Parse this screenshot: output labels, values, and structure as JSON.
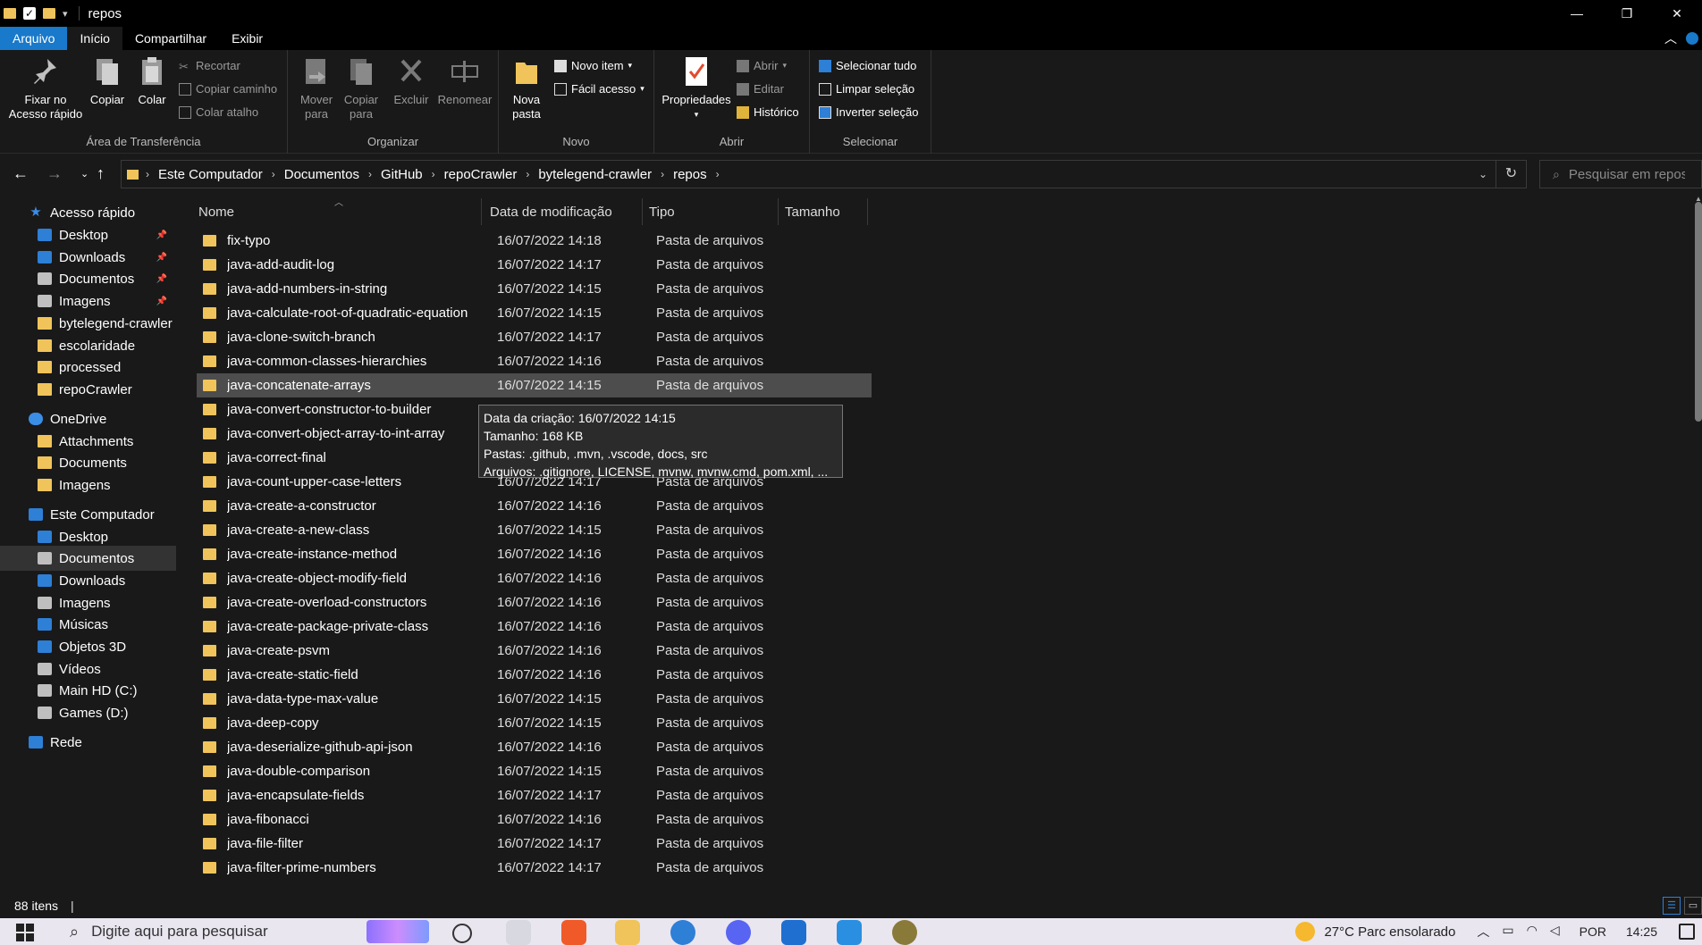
{
  "window": {
    "title": "repos",
    "controls": {
      "minimize": "—",
      "maximize": "❐",
      "close": "✕"
    }
  },
  "ribbon_tabs": [
    "Arquivo",
    "Início",
    "Compartilhar",
    "Exibir"
  ],
  "ribbon": {
    "clipboard": {
      "label": "Área de Transferência",
      "pin": "Fixar no Acesso rápido",
      "copy": "Copiar",
      "paste": "Colar",
      "cut": "Recortar",
      "copy_path": "Copiar caminho",
      "paste_shortcut": "Colar atalho"
    },
    "organize": {
      "label": "Organizar",
      "move_to": "Mover para",
      "copy_to": "Copiar para",
      "delete": "Excluir",
      "rename": "Renomear"
    },
    "new": {
      "label": "Novo",
      "new_folder": "Nova pasta",
      "new_item": "Novo item",
      "easy_access": "Fácil acesso"
    },
    "open": {
      "label": "Abrir",
      "properties": "Propriedades",
      "open": "Abrir",
      "edit": "Editar",
      "history": "Histórico"
    },
    "select": {
      "label": "Selecionar",
      "select_all": "Selecionar tudo",
      "select_none": "Limpar seleção",
      "invert": "Inverter seleção"
    }
  },
  "breadcrumb": [
    "Este Computador",
    "Documentos",
    "GitHub",
    "repoCrawler",
    "bytelegend-crawler",
    "repos"
  ],
  "search": {
    "placeholder": "Pesquisar em repos"
  },
  "nav": [
    {
      "label": "Acesso rápido",
      "icon": "star-icon",
      "level": 0,
      "pinned": false
    },
    {
      "label": "Desktop",
      "icon": "desktop-icon",
      "level": 1,
      "pinned": true
    },
    {
      "label": "Downloads",
      "icon": "download-icon",
      "level": 1,
      "pinned": true
    },
    {
      "label": "Documentos",
      "icon": "documents-icon",
      "level": 1,
      "pinned": true
    },
    {
      "label": "Imagens",
      "icon": "pictures-icon",
      "level": 1,
      "pinned": true
    },
    {
      "label": "bytelegend-crawler",
      "icon": "folder-icon",
      "level": 1,
      "pinned": false
    },
    {
      "label": "escolaridade",
      "icon": "folder-icon",
      "level": 1,
      "pinned": false
    },
    {
      "label": "processed",
      "icon": "folder-icon",
      "level": 1,
      "pinned": false
    },
    {
      "label": "repoCrawler",
      "icon": "folder-icon",
      "level": 1,
      "pinned": false
    },
    {
      "label": "OneDrive",
      "icon": "cloud-icon",
      "level": 0,
      "pinned": false
    },
    {
      "label": "Attachments",
      "icon": "folder-icon",
      "level": 1,
      "pinned": false
    },
    {
      "label": "Documents",
      "icon": "folder-icon",
      "level": 1,
      "pinned": false
    },
    {
      "label": "Imagens",
      "icon": "folder-icon",
      "level": 1,
      "pinned": false
    },
    {
      "label": "Este Computador",
      "icon": "computer-icon",
      "level": 0,
      "pinned": false
    },
    {
      "label": "Desktop",
      "icon": "desktop-icon",
      "level": 1,
      "pinned": false
    },
    {
      "label": "Documentos",
      "icon": "documents-icon",
      "level": 1,
      "pinned": false,
      "selected": true
    },
    {
      "label": "Downloads",
      "icon": "download-icon",
      "level": 1,
      "pinned": false
    },
    {
      "label": "Imagens",
      "icon": "pictures-icon",
      "level": 1,
      "pinned": false
    },
    {
      "label": "Músicas",
      "icon": "music-icon",
      "level": 1,
      "pinned": false
    },
    {
      "label": "Objetos 3D",
      "icon": "objects-3d-icon",
      "level": 1,
      "pinned": false
    },
    {
      "label": "Vídeos",
      "icon": "videos-icon",
      "level": 1,
      "pinned": false
    },
    {
      "label": "Main HD (C:)",
      "icon": "drive-icon",
      "level": 1,
      "pinned": false
    },
    {
      "label": "Games (D:)",
      "icon": "drive-icon",
      "level": 1,
      "pinned": false
    },
    {
      "label": "Rede",
      "icon": "network-icon",
      "level": 0,
      "pinned": false
    }
  ],
  "columns": [
    "Nome",
    "Data de modificação",
    "Tipo",
    "Tamanho"
  ],
  "files": [
    {
      "name": "fix-typo",
      "date": "16/07/2022 14:18",
      "type": "Pasta de arquivos"
    },
    {
      "name": "java-add-audit-log",
      "date": "16/07/2022 14:17",
      "type": "Pasta de arquivos"
    },
    {
      "name": "java-add-numbers-in-string",
      "date": "16/07/2022 14:15",
      "type": "Pasta de arquivos"
    },
    {
      "name": "java-calculate-root-of-quadratic-equation",
      "date": "16/07/2022 14:15",
      "type": "Pasta de arquivos"
    },
    {
      "name": "java-clone-switch-branch",
      "date": "16/07/2022 14:17",
      "type": "Pasta de arquivos"
    },
    {
      "name": "java-common-classes-hierarchies",
      "date": "16/07/2022 14:16",
      "type": "Pasta de arquivos"
    },
    {
      "name": "java-concatenate-arrays",
      "date": "16/07/2022 14:15",
      "type": "Pasta de arquivos",
      "hover": true
    },
    {
      "name": "java-convert-constructor-to-builder",
      "date": "",
      "type": ""
    },
    {
      "name": "java-convert-object-array-to-int-array",
      "date": "",
      "type": ""
    },
    {
      "name": "java-correct-final",
      "date": "",
      "type": ""
    },
    {
      "name": "java-count-upper-case-letters",
      "date": "16/07/2022 14:17",
      "type": "Pasta de arquivos"
    },
    {
      "name": "java-create-a-constructor",
      "date": "16/07/2022 14:16",
      "type": "Pasta de arquivos"
    },
    {
      "name": "java-create-a-new-class",
      "date": "16/07/2022 14:15",
      "type": "Pasta de arquivos"
    },
    {
      "name": "java-create-instance-method",
      "date": "16/07/2022 14:16",
      "type": "Pasta de arquivos"
    },
    {
      "name": "java-create-object-modify-field",
      "date": "16/07/2022 14:16",
      "type": "Pasta de arquivos"
    },
    {
      "name": "java-create-overload-constructors",
      "date": "16/07/2022 14:16",
      "type": "Pasta de arquivos"
    },
    {
      "name": "java-create-package-private-class",
      "date": "16/07/2022 14:16",
      "type": "Pasta de arquivos"
    },
    {
      "name": "java-create-psvm",
      "date": "16/07/2022 14:16",
      "type": "Pasta de arquivos"
    },
    {
      "name": "java-create-static-field",
      "date": "16/07/2022 14:16",
      "type": "Pasta de arquivos"
    },
    {
      "name": "java-data-type-max-value",
      "date": "16/07/2022 14:15",
      "type": "Pasta de arquivos"
    },
    {
      "name": "java-deep-copy",
      "date": "16/07/2022 14:15",
      "type": "Pasta de arquivos"
    },
    {
      "name": "java-deserialize-github-api-json",
      "date": "16/07/2022 14:16",
      "type": "Pasta de arquivos"
    },
    {
      "name": "java-double-comparison",
      "date": "16/07/2022 14:15",
      "type": "Pasta de arquivos"
    },
    {
      "name": "java-encapsulate-fields",
      "date": "16/07/2022 14:17",
      "type": "Pasta de arquivos"
    },
    {
      "name": "java-fibonacci",
      "date": "16/07/2022 14:16",
      "type": "Pasta de arquivos"
    },
    {
      "name": "java-file-filter",
      "date": "16/07/2022 14:17",
      "type": "Pasta de arquivos"
    },
    {
      "name": "java-filter-prime-numbers",
      "date": "16/07/2022 14:17",
      "type": "Pasta de arquivos"
    }
  ],
  "tooltip": {
    "created": "Data da criação: 16/07/2022 14:15",
    "size": "Tamanho: 168 KB",
    "folders": "Pastas: .github, .mvn, .vscode, docs, src",
    "files": "Arquivos: .gitignore, LICENSE, mvnw, mvnw.cmd, pom.xml, ..."
  },
  "status": {
    "count": "88 itens"
  },
  "taskbar": {
    "search_placeholder": "Digite aqui para pesquisar",
    "weather": "27°C  Parc ensolarado",
    "lang": "POR",
    "time": "14:25"
  },
  "colors": {
    "accent": "#1979ca",
    "folder": "#f0c45a",
    "background": "#191919"
  }
}
